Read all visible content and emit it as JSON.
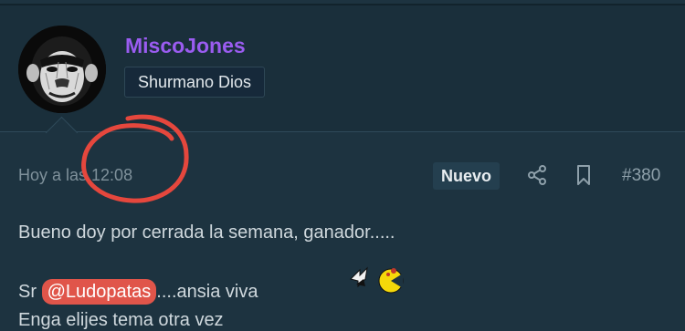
{
  "user": {
    "name": "MiscoJones",
    "title": "Shurmano Dios"
  },
  "post": {
    "timestamp": "Hoy a las 12:08",
    "badge": "Nuevo",
    "number": "#380",
    "line1": "Bueno doy por cerrada la semana, ganador.....",
    "line2_prefix": "Sr",
    "mention": "@Ludopatas",
    "line2_suffix": "....ansia viva",
    "line3": "Enga elijes tema otra vez"
  },
  "icons": {
    "share": "share-icon",
    "bookmark": "bookmark-icon",
    "emoji": "pacman-emoji-icon",
    "avatar": "chimpanzee-avatar"
  },
  "colors": {
    "username": "#9a5cf0",
    "mention": "#e0554a",
    "annotation": "#e5473d",
    "background": "#1d3340"
  }
}
